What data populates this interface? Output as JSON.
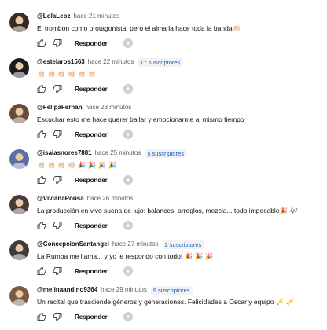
{
  "colors": {
    "accent": "#065fd4",
    "meta": "#606060",
    "badge_bg": "#f2f2f2"
  },
  "reply_label": "Responder",
  "comments": [
    {
      "author": "@LolaLeoz",
      "time": "hace 21 minutos",
      "subscribers": "",
      "text": "El trombón como protagonista, pero el alma la hace toda la banda👏🏻",
      "avatar_color": "#3a2a24"
    },
    {
      "author": "@estelaros1563",
      "time": "hace 22 minutos",
      "subscribers": "17 suscriptores",
      "text": "👏🏻 👏🏻 👏🏻 👏🏻 👏🏻 👏🏻",
      "avatar_color": "#1c1c1c"
    },
    {
      "author": "@FelipaFernán",
      "time": "hace 23 minutos",
      "subscribers": "",
      "text": "Escuchar esto me hace querer bailar y emocionarme al mismo tiempo",
      "avatar_color": "#6b4a3a"
    },
    {
      "author": "@isaiasnores7881",
      "time": "hace 25 minutos",
      "subscribers": "5 suscriptores",
      "text": "👏🏻 👏🏻 👏🏻 👏🏻 🎉 🎉 🎉 🎉",
      "avatar_color": "#5b6fa0"
    },
    {
      "author": "@VivianaPousa",
      "time": "hace 26 minutos",
      "subscribers": "",
      "text": "La producción en vivo suena de lujo: balances, arreglos, mezcla... todo impecable🎉 🎶",
      "avatar_color": "#4a3a33"
    },
    {
      "author": "@ConcepcionSantangel",
      "time": "hace 27 minutos",
      "subscribers": "2 suscriptores",
      "text": "La Rumba me llama... y yo le respondo con todo! 🎉 🎉 🎉",
      "avatar_color": "#3f3b3a"
    },
    {
      "author": "@melinaandino9364",
      "time": "hace 29 minutos",
      "subscribers": "9 suscriptores",
      "text": "Un recital que trasciende géneros y generaciones. Felicidades a Oscar y equipo 🎺 🎺",
      "avatar_color": "#7a5a44"
    }
  ]
}
